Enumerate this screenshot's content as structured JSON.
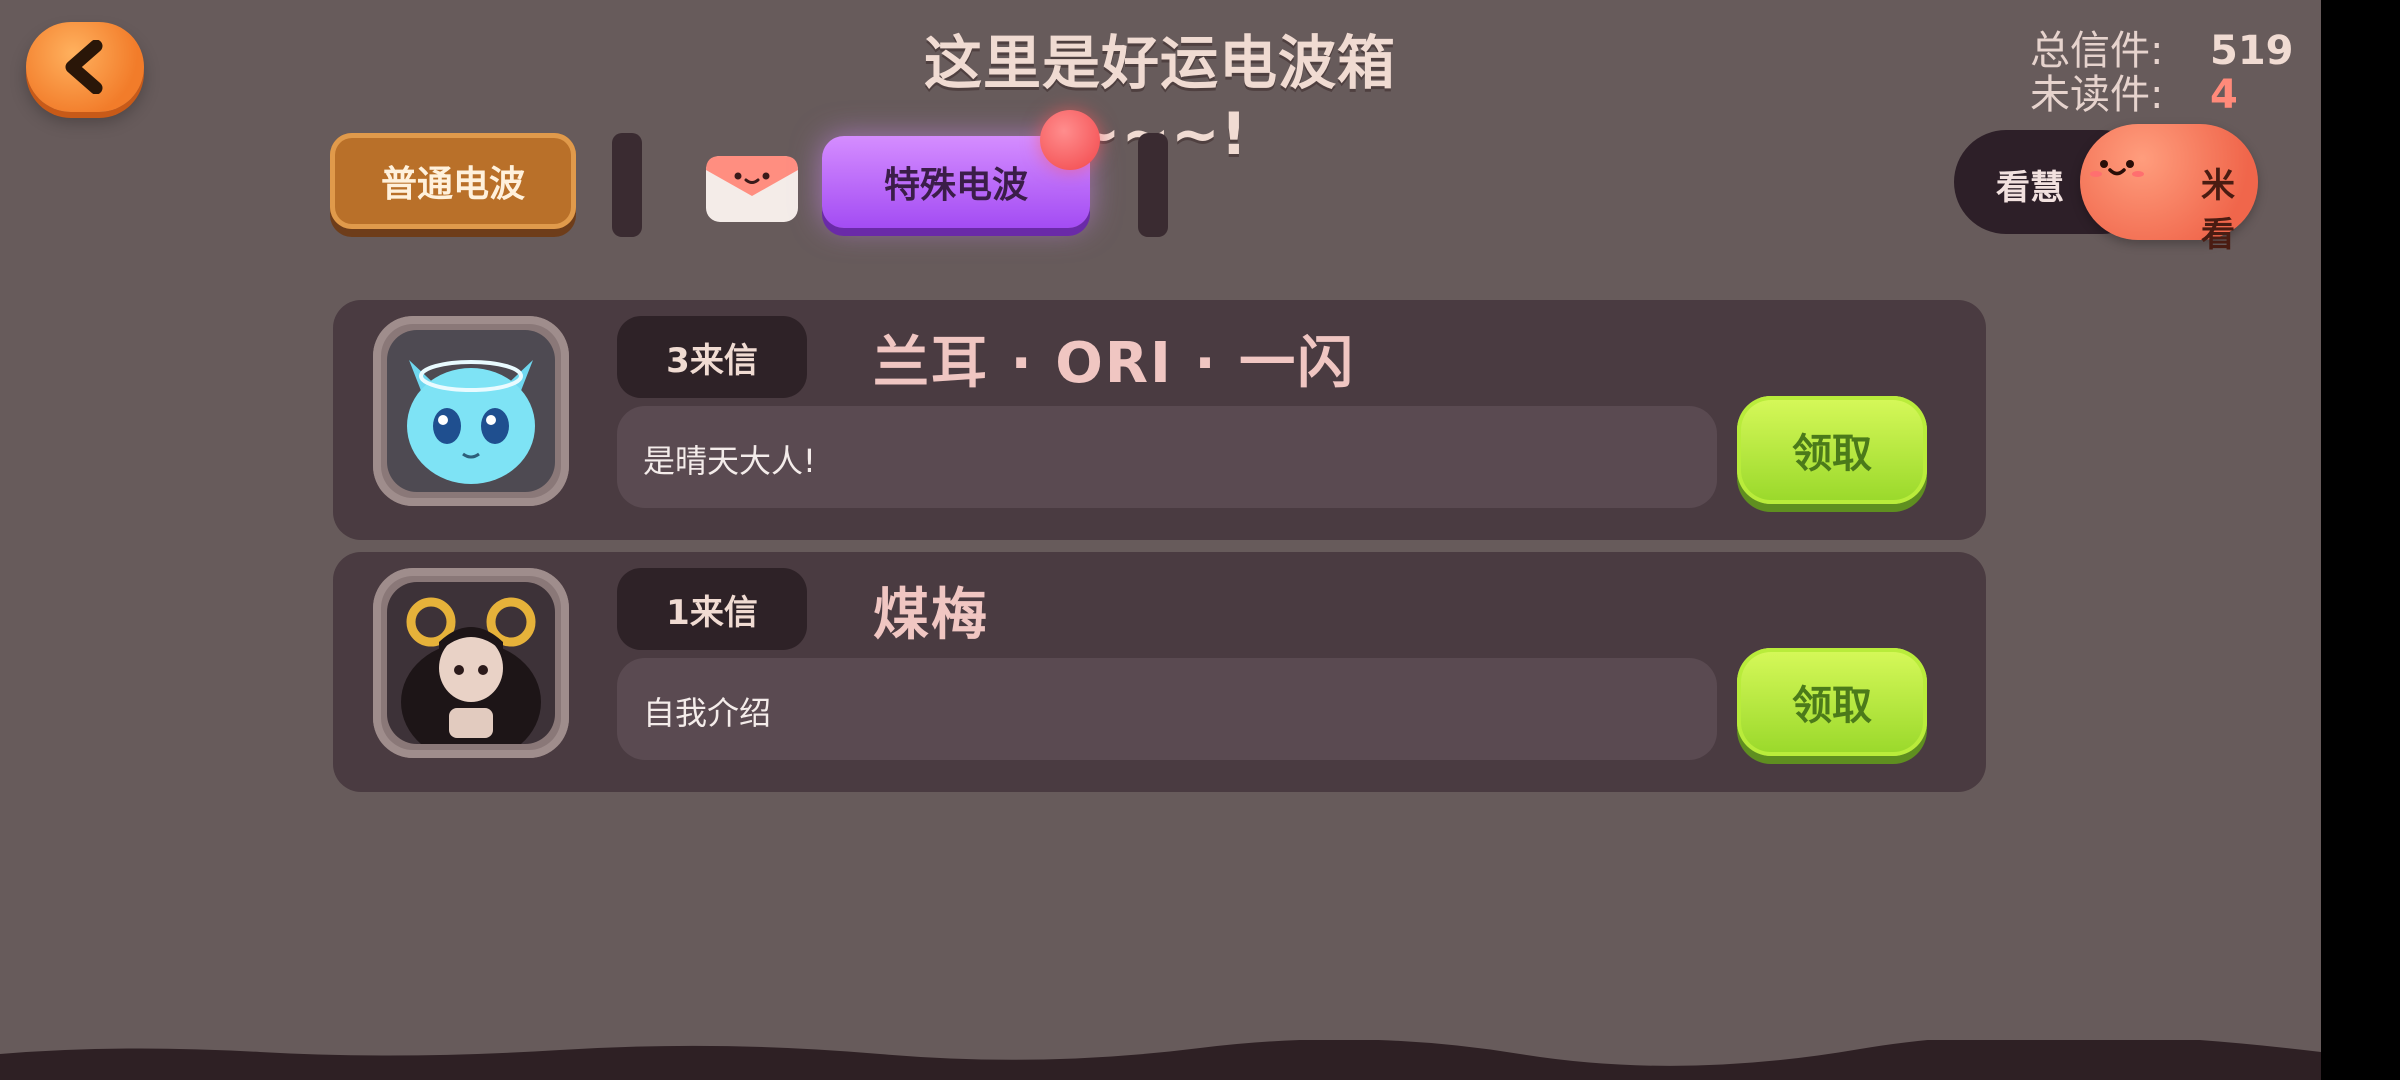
{
  "header": {
    "title": "这里是好运电波箱~~~!",
    "total_label": "总信件:",
    "total_value": "519",
    "unread_label": "未读件:",
    "unread_value": "4"
  },
  "tabs": [
    {
      "label": "普通电波",
      "active": false
    },
    {
      "label": "特殊电波",
      "active": true
    }
  ],
  "watch_button": {
    "label_left": "看慧",
    "label_right": "米看"
  },
  "letters": [
    {
      "count": "3来信",
      "sender": "兰耳 · ORI · 一闪",
      "message": "是晴天大人!",
      "action": "领取"
    },
    {
      "count": "1来信",
      "sender": "煤梅",
      "message": "自我介绍",
      "action": "领取"
    }
  ],
  "colors": {
    "background": "#675b5b",
    "card": "#4a3b41",
    "claim": "#b6ec3a",
    "special_tab": "#b85cf6",
    "normal_tab": "#b97029"
  }
}
